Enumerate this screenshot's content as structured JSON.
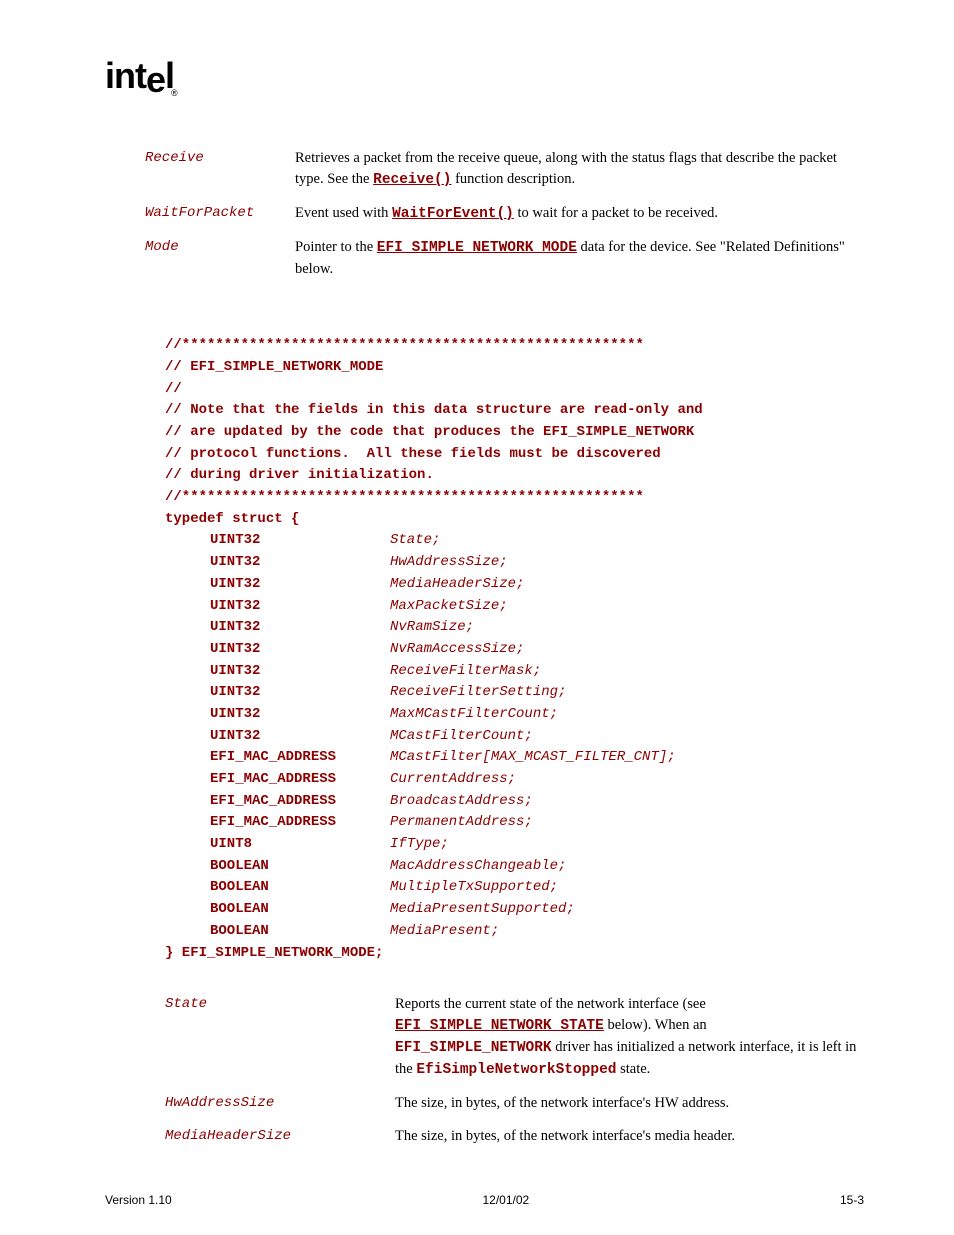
{
  "logo": "intel",
  "defs1": [
    {
      "term": "Receive",
      "segments": [
        {
          "t": "Retrieves a packet from the receive queue, along with the status flags that describe the packet type.  See the "
        },
        {
          "t": "Receive()",
          "cls": "code-link"
        },
        {
          "t": " function description."
        }
      ]
    },
    {
      "term": "WaitForPacket",
      "segments": [
        {
          "t": "Event used with "
        },
        {
          "t": "WaitForEvent()",
          "cls": "code-link"
        },
        {
          "t": " to wait for a packet to be received."
        }
      ]
    },
    {
      "term": "Mode",
      "segments": [
        {
          "t": "Pointer to the "
        },
        {
          "t": "EFI_SIMPLE_NETWORK_MODE",
          "cls": "code-link"
        },
        {
          "t": " data for the device.  See \"Related Definitions\" below."
        }
      ]
    }
  ],
  "code_header": [
    "//*******************************************************",
    "// EFI_SIMPLE_NETWORK_MODE",
    "//",
    "// Note that the fields in this data structure are read-only and",
    "// are updated by the code that produces the EFI_SIMPLE_NETWORK",
    "// protocol functions.  All these fields must be discovered",
    "// during driver initialization.",
    "//*******************************************************",
    "typedef struct {"
  ],
  "struct_fields": [
    {
      "type": "UINT32",
      "field": "State;"
    },
    {
      "type": "UINT32",
      "field": "HwAddressSize;"
    },
    {
      "type": "UINT32",
      "field": "MediaHeaderSize;"
    },
    {
      "type": "UINT32",
      "field": "MaxPacketSize;"
    },
    {
      "type": "UINT32",
      "field": "NvRamSize;"
    },
    {
      "type": "UINT32",
      "field": "NvRamAccessSize;"
    },
    {
      "type": "UINT32",
      "field": "ReceiveFilterMask;"
    },
    {
      "type": "UINT32",
      "field": "ReceiveFilterSetting;"
    },
    {
      "type": "UINT32",
      "field": "MaxMCastFilterCount;"
    },
    {
      "type": "UINT32",
      "field": "MCastFilterCount;"
    },
    {
      "type": "EFI_MAC_ADDRESS",
      "field": "MCastFilter[MAX_MCAST_FILTER_CNT];"
    },
    {
      "type": "EFI_MAC_ADDRESS",
      "field": "CurrentAddress;"
    },
    {
      "type": "EFI_MAC_ADDRESS",
      "field": "BroadcastAddress;"
    },
    {
      "type": "EFI_MAC_ADDRESS",
      "field": "PermanentAddress;"
    },
    {
      "type": "UINT8",
      "field": "IfType;"
    },
    {
      "type": "BOOLEAN",
      "field": "MacAddressChangeable;"
    },
    {
      "type": "BOOLEAN",
      "field": "MultipleTxSupported;"
    },
    {
      "type": "BOOLEAN",
      "field": "MediaPresentSupported;"
    },
    {
      "type": "BOOLEAN",
      "field": "MediaPresent;"
    }
  ],
  "code_footer": "} EFI_SIMPLE_NETWORK_MODE;",
  "defs2": [
    {
      "term": "State",
      "segments": [
        {
          "t": "Reports the current state of the network interface (see "
        },
        {
          "t": "EFI_SIMPLE_NETWORK_STATE",
          "cls": "code-link"
        },
        {
          "t": " below).  When an "
        },
        {
          "t": "EFI_SIMPLE_NETWORK",
          "cls": "code-plain"
        },
        {
          "t": " driver has initialized a network interface, it is left in the "
        },
        {
          "t": "EfiSimpleNetworkStopped",
          "cls": "code-plain"
        },
        {
          "t": " state."
        }
      ]
    },
    {
      "term": "HwAddressSize",
      "segments": [
        {
          "t": "The size, in bytes, of the network interface's HW address."
        }
      ]
    },
    {
      "term": "MediaHeaderSize",
      "segments": [
        {
          "t": "The size, in bytes, of the network interface's media header."
        }
      ]
    }
  ],
  "footer": {
    "left": "Version 1.10",
    "center": "12/01/02",
    "right": "15-3"
  }
}
